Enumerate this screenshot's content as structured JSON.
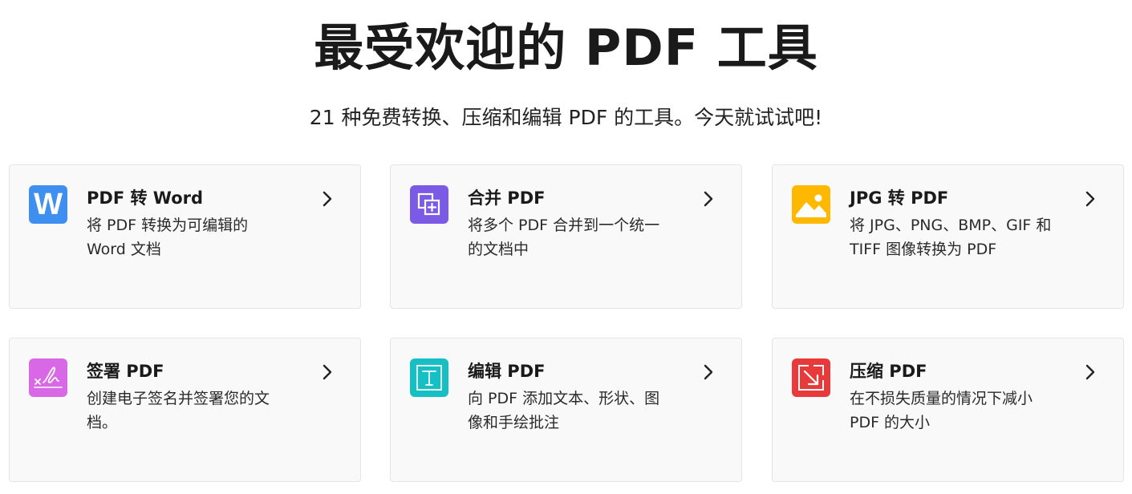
{
  "header": {
    "title": "最受欢迎的 PDF 工具",
    "subtitle": "21 种免费转换、压缩和编辑 PDF 的工具。今天就试试吧!"
  },
  "tools": [
    {
      "title": "PDF 转 Word",
      "desc_lines": [
        "将 PDF 转换为可编辑的",
        "Word 文档"
      ],
      "icon": "word-icon",
      "icon_letter": "W",
      "color": "#3f8ff0"
    },
    {
      "title": "合并 PDF",
      "desc_lines": [
        "将多个 PDF 合并到一个统一",
        "的文档中"
      ],
      "icon": "merge-icon",
      "color": "#7b5be6"
    },
    {
      "title": "JPG 转 PDF",
      "desc_lines": [
        "将 JPG、PNG、BMP、GIF 和",
        "TIFF 图像转换为 PDF"
      ],
      "icon": "image-icon",
      "color": "#ffb800"
    },
    {
      "title": "签署 PDF",
      "desc_lines": [
        "创建电子签名并签署您的文",
        "档。"
      ],
      "icon": "signature-icon",
      "color": "#d968e6"
    },
    {
      "title": "编辑 PDF",
      "desc_lines": [
        "向 PDF 添加文本、形状、图",
        "像和手绘批注"
      ],
      "icon": "text-edit-icon",
      "icon_letter": "T",
      "color": "#16bfc4"
    },
    {
      "title": "压缩 PDF",
      "desc_lines": [
        "在不损失质量的情况下减小",
        "PDF 的大小"
      ],
      "icon": "compress-icon",
      "color": "#e83a3a"
    }
  ]
}
